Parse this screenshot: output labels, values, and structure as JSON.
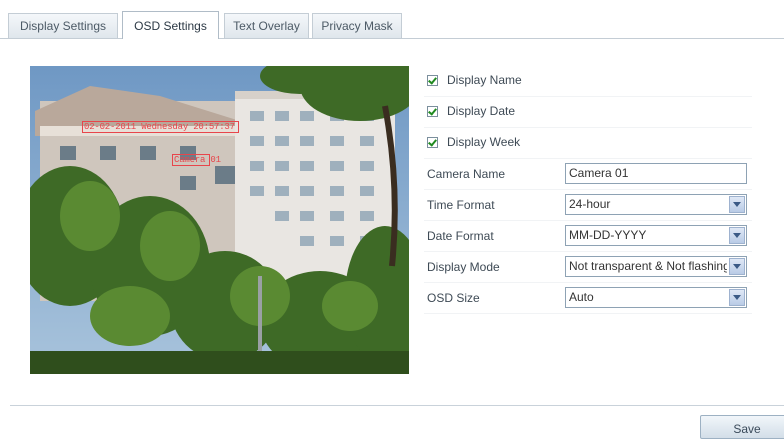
{
  "tabs": [
    {
      "label": "Display Settings",
      "active": false
    },
    {
      "label": "OSD Settings",
      "active": true
    },
    {
      "label": "Text Overlay",
      "active": false
    },
    {
      "label": "Privacy Mask",
      "active": false
    }
  ],
  "preview": {
    "osd_datetime": "02-02-2011 Wednesday 20:57:37",
    "osd_name": "Camera 01",
    "osd_color": "#e8454b"
  },
  "checkboxes": [
    {
      "label": "Display Name",
      "checked": true
    },
    {
      "label": "Display Date",
      "checked": true
    },
    {
      "label": "Display Week",
      "checked": true
    }
  ],
  "fields": {
    "camera_name": {
      "label": "Camera Name",
      "value": "Camera 01"
    },
    "time_format": {
      "label": "Time Format",
      "value": "24-hour"
    },
    "date_format": {
      "label": "Date Format",
      "value": "MM-DD-YYYY"
    },
    "display_mode": {
      "label": "Display Mode",
      "value": "Not transparent & Not flashing"
    },
    "osd_size": {
      "label": "OSD Size",
      "value": "Auto"
    }
  },
  "footer": {
    "save_label": "Save"
  }
}
